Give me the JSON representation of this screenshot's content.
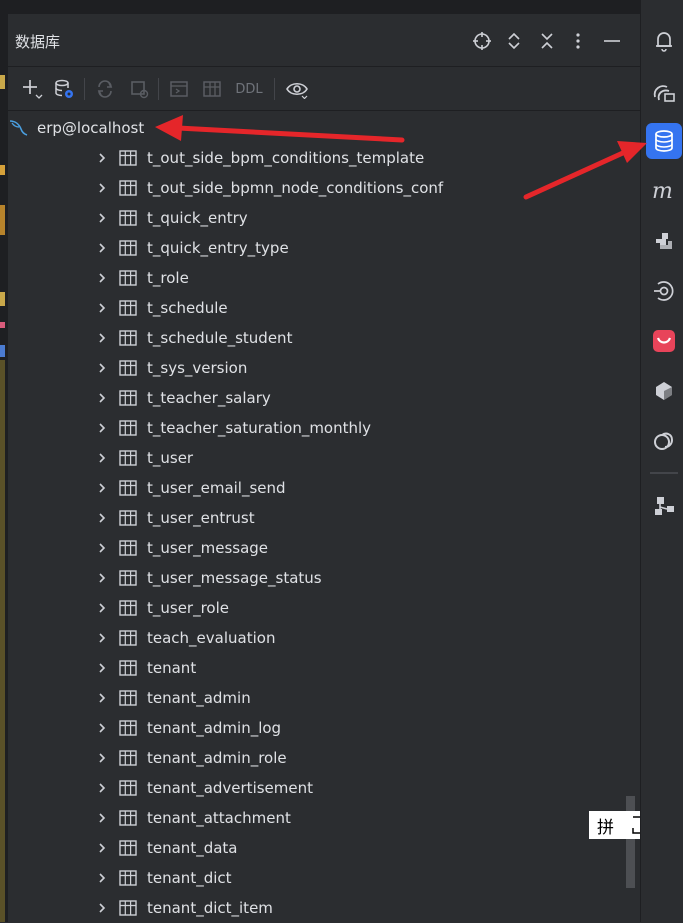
{
  "panel": {
    "title": "数据库"
  },
  "header_icons": [
    "locate-icon",
    "expand-all-icon",
    "collapse-all-icon",
    "more-options-icon",
    "minimize-icon"
  ],
  "toolbar": {
    "ddl_label": "DDL",
    "icons": [
      "add-icon",
      "data-source-properties-icon",
      "refresh-icon",
      "jump-to-query-console-icon",
      "open-console-icon",
      "table-view-icon",
      "view-options-eye-icon"
    ]
  },
  "connection": {
    "label": "erp@localhost",
    "icon": "mysql-dolphin-icon"
  },
  "tables": [
    "t_out_side_bpm_conditions_template",
    "t_out_side_bpmn_node_conditions_conf",
    "t_quick_entry",
    "t_quick_entry_type",
    "t_role",
    "t_schedule",
    "t_schedule_student",
    "t_sys_version",
    "t_teacher_salary",
    "t_teacher_saturation_monthly",
    "t_user",
    "t_user_email_send",
    "t_user_entrust",
    "t_user_message",
    "t_user_message_status",
    "t_user_role",
    "teach_evaluation",
    "tenant",
    "tenant_admin",
    "tenant_admin_log",
    "tenant_admin_role",
    "tenant_advertisement",
    "tenant_attachment",
    "tenant_data",
    "tenant_dict",
    "tenant_dict_item"
  ],
  "ime": {
    "glyph": "拼"
  },
  "right_toolbar": [
    "notifications-bell-icon",
    "ai-assistant-icon",
    "database-icon",
    "maven-icon",
    "plugin-puzzle-icon",
    "services-target-icon",
    "code-with-me-icon",
    "stack-icon",
    "copilot-icon",
    "structure-icon"
  ],
  "colors": {
    "accent": "#3574f0",
    "annotation_arrow": "#e5262a",
    "background": "#2b2d30"
  }
}
